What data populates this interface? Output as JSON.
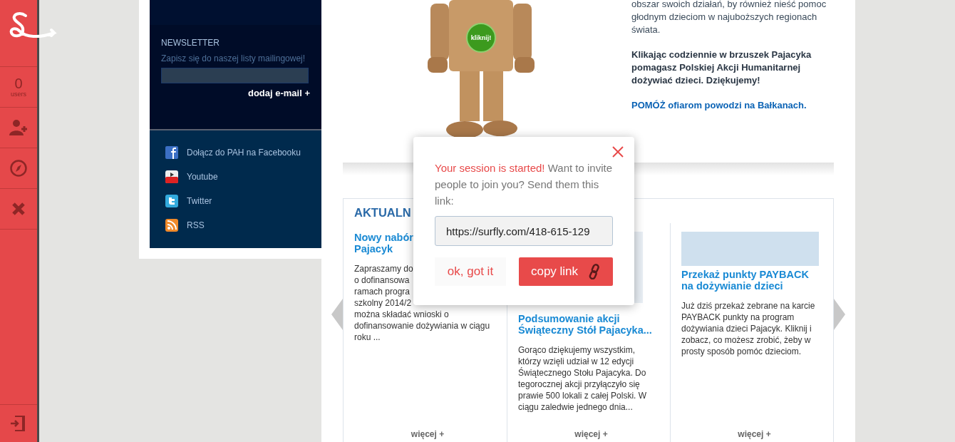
{
  "sidebar": {
    "users_count": "0",
    "users_label": "users"
  },
  "newsletter": {
    "title": "NEWSLETTER",
    "text": "Zapisz się do naszej listy mailingowej!",
    "add_label": "dodaj e-mail +"
  },
  "social": [
    {
      "kind": "facebook",
      "label": "Dołącz do PAH na Facebooku"
    },
    {
      "kind": "youtube",
      "label": "Youtube"
    },
    {
      "kind": "twitter",
      "label": "Twitter"
    },
    {
      "kind": "rss",
      "label": "RSS"
    }
  ],
  "hero": {
    "button": "kliknij!",
    "intro": "obszar swoich działań, by również nieść pomoc głodnym dzieciom w najuboższych regionach świata.",
    "bold_text": "Klikając codziennie w brzuszek Pajacyka pomagasz Polskiej Akcji Humanitarnej dożywiać dzieci. Dziękujemy!",
    "link": "POMÓŻ ofiarom powodzi na Bałkanach."
  },
  "tabs": [
    {
      "label": "AKTUALN",
      "selected": true
    }
  ],
  "cards": [
    {
      "kind": "text",
      "title": [
        "Nowy nabór",
        "Pajacyk"
      ],
      "body": [
        "Zapraszamy do",
        "o dofinansowa",
        "ramach progra",
        "szkolny 2014/2",
        "można składać wnioski o",
        "dofinansowanie dożywiania w ciągu",
        "roku ..."
      ],
      "more": "więcej +"
    },
    {
      "kind": "poster",
      "title": [
        "Podsumowanie akcji",
        "Świąteczny Stół Pajacyka..."
      ],
      "body": [
        "Gorąco dziękujemy wszystkim,",
        "którzy wzięli udział w 12 edycji",
        "Świątecznego Stołu Pajacyka. Do",
        "tegorocznej akcji przyłączyło się",
        "prawie 500 lokali z całej Polski. W",
        "ciągu zaledwie jednego dnia..."
      ],
      "more": "więcej +"
    },
    {
      "kind": "banner",
      "title": [
        "Przekaż punkty PAYBACK",
        "na dożywianie dzieci"
      ],
      "body": [
        "Już dziś przekaż zebrane na karcie",
        "PAYBACK punkty na program",
        "dożywiania dzieci Pajacyk. Kliknij i",
        "zobacz, co możesz zrobić, żeby w",
        "prosty sposób pomóc dzieciom."
      ],
      "more": "więcej +"
    }
  ],
  "modal": {
    "highlight": "Your session is started!",
    "message": "Want to invite people to join you? Send them this link:",
    "link_value": "https://surfly.com/418-615-129",
    "dismiss": "ok, got it",
    "copy": "copy link"
  }
}
